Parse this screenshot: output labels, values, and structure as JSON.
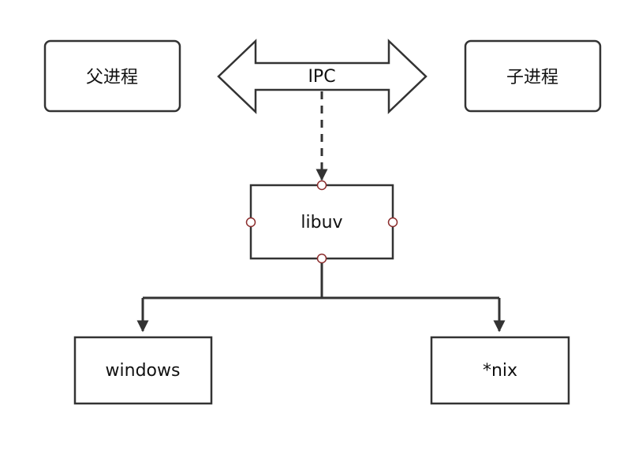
{
  "diagram": {
    "nodes": {
      "parent": "父进程",
      "child": "子进程",
      "ipc": "IPC",
      "libuv": "libuv",
      "windows": "windows",
      "nix": "*nix"
    },
    "colors": {
      "stroke": "#333333",
      "handle": "#8b2c2c",
      "background": "#ffffff"
    }
  }
}
